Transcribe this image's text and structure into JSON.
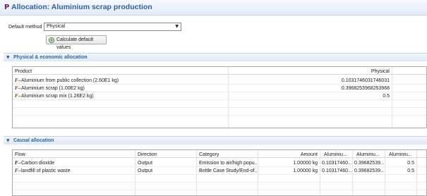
{
  "header": {
    "icon": "P",
    "title": "Allocation: Aluminium scrap production"
  },
  "default_method": {
    "label": "Default method",
    "value": "Physical"
  },
  "calc_button": {
    "label": "Calculate default values"
  },
  "physical_section": {
    "title": "Physical & economic allocation"
  },
  "physical_table": {
    "headers": [
      "Product",
      "Physical"
    ],
    "rows": [
      {
        "product": "Aluminium from public collection (2.60E1 kg)",
        "physical": "0.1031746031746031"
      },
      {
        "product": "Aluminium scrap (1.00E2 kg)",
        "physical": "0.3968253968253968"
      },
      {
        "product": "Aluminium scrap mix (1.26E2 kg)",
        "physical": "0.5"
      }
    ]
  },
  "causal_section": {
    "title": "Causal allocation"
  },
  "causal_table": {
    "headers": [
      "Flow",
      "Direction",
      "Category",
      "Amount",
      "Aluminiu...",
      "Aluminiu...",
      "Aluminiu..."
    ],
    "rows": [
      {
        "flow": "Carbon dioxide",
        "direction": "Output",
        "category": "Emission to air/high popu...",
        "amount": "1.00000 kg",
        "a1": "0.103174​60...",
        "a2": "0.396825​39...",
        "a3": "0.5"
      },
      {
        "flow": "landfill of plastic waste",
        "direction": "Output",
        "category": "Bottle Case Study/End-of...",
        "amount": "1.00000 kg",
        "a1": "0.103174​60...",
        "a2": "0.396825​39...",
        "a3": "0.5"
      }
    ]
  }
}
